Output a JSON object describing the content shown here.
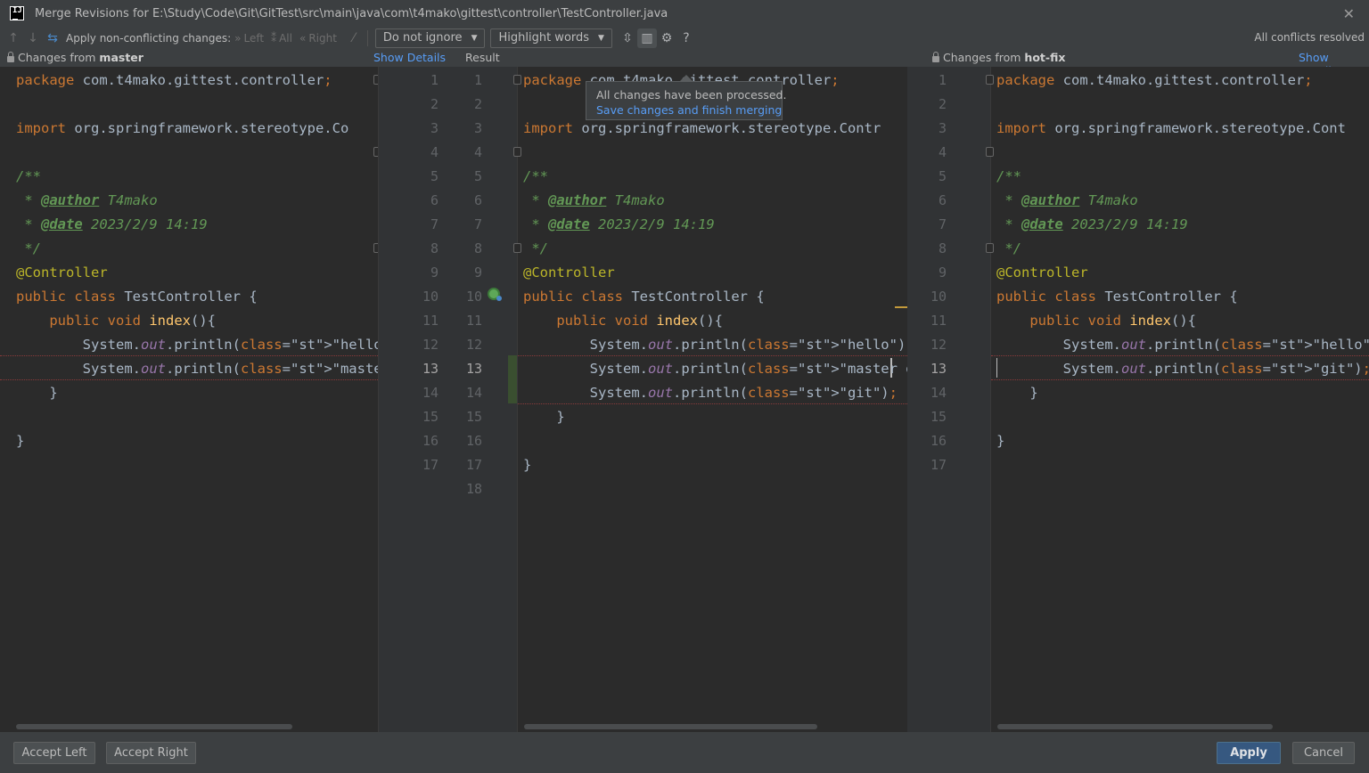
{
  "window": {
    "title": "Merge Revisions for E:\\Study\\Code\\Git\\GitTest\\src\\main\\java\\com\\t4mako\\gittest\\controller\\TestController.java",
    "logo_text": "IJ"
  },
  "toolbar": {
    "apply_label": "Apply non-conflicting changes:",
    "left_label": "Left",
    "all_label": "All",
    "right_label": "Right",
    "ignore_dropdown": "Do not ignore",
    "highlight_dropdown": "Highlight words",
    "help_label": "?",
    "status": "All conflicts resolved"
  },
  "headers": {
    "left_prefix": "Changes from",
    "left_branch": "master",
    "left_link": "Show Details",
    "center": "Result",
    "right_prefix": "Changes from",
    "right_branch": "hot-fix",
    "right_link": "Show Details"
  },
  "tooltip": {
    "message": "All changes have been processed.",
    "link": "Save changes and finish merging"
  },
  "left_pane": {
    "lines": [
      "package com.t4mako.gittest.controller;",
      "",
      "import org.springframework.stereotype.Co",
      "",
      "/**",
      " * @author T4mako",
      " * @date 2023/2/9 14:19",
      " */",
      "@Controller",
      "public class TestController {",
      "    public void index(){",
      "        System.out.println(\"hello\");",
      "        System.out.println(\"master git\")",
      "    }",
      "",
      "}",
      ""
    ]
  },
  "gutter_left_numbers": [
    "1",
    "2",
    "3",
    "4",
    "5",
    "6",
    "7",
    "8",
    "9",
    "10",
    "11",
    "12",
    "13",
    "14",
    "15",
    "16",
    "17"
  ],
  "gutter_result_numbers": [
    "1",
    "2",
    "3",
    "4",
    "5",
    "6",
    "7",
    "8",
    "9",
    "10",
    "11",
    "12",
    "13",
    "14",
    "15",
    "16",
    "17",
    "18"
  ],
  "gutter_right_numbers": [
    "1",
    "2",
    "3",
    "4",
    "5",
    "6",
    "7",
    "8",
    "9",
    "10",
    "11",
    "12",
    "13",
    "14",
    "15",
    "16",
    "17"
  ],
  "result_pane": {
    "lines": [
      "package com.t4mako.gittest.controller;",
      "",
      "import org.springframework.stereotype.Contr",
      "",
      "/**",
      " * @author T4mako",
      " * @date 2023/2/9 14:19",
      " */",
      "@Controller",
      "public class TestController {",
      "    public void index(){",
      "        System.out.println(\"hello\");",
      "        System.out.println(\"master git\");",
      "        System.out.println(\"git\");",
      "    }",
      "",
      "}",
      ""
    ]
  },
  "right_pane": {
    "lines": [
      "package com.t4mako.gittest.controller;",
      "",
      "import org.springframework.stereotype.Cont",
      "",
      "/**",
      " * @author T4mako",
      " * @date 2023/2/9 14:19",
      " */",
      "@Controller",
      "public class TestController {",
      "    public void index(){",
      "        System.out.println(\"hello\");",
      "        System.out.println(\"git\");",
      "    }",
      "",
      "}",
      ""
    ]
  },
  "footer": {
    "accept_left": "Accept Left",
    "accept_right": "Accept Right",
    "apply": "Apply",
    "cancel": "Cancel"
  },
  "colors": {
    "background": "#2b2b2b",
    "chrome": "#3c3f41",
    "keyword": "#cc7832",
    "string": "#6a8759",
    "comment": "#629755",
    "annotation": "#bbb529",
    "function": "#ffc66d",
    "link": "#589df6",
    "primary_button": "#365880"
  }
}
